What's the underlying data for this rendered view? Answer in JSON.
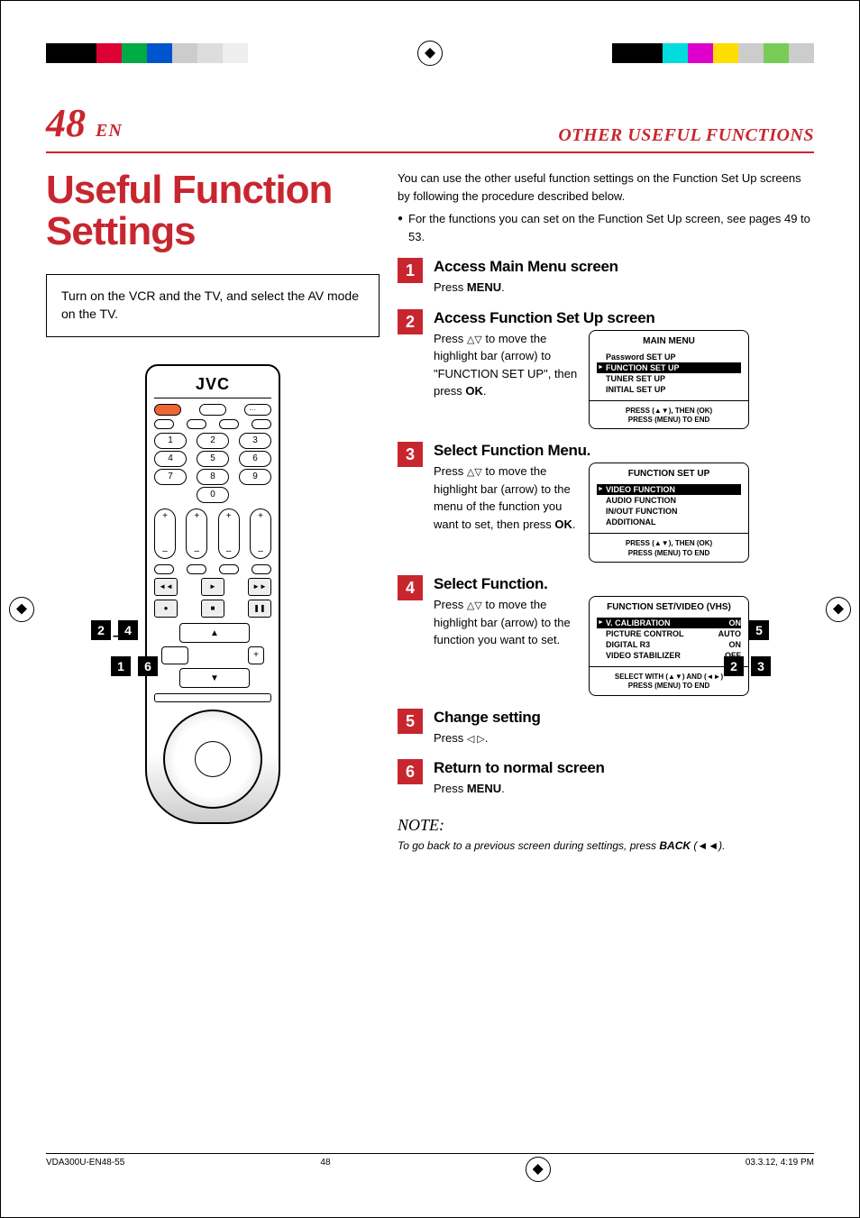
{
  "header": {
    "page_number": "48",
    "lang": "EN",
    "section_title": "OTHER USEFUL FUNCTIONS"
  },
  "main_title_line1": "Useful Function",
  "main_title_line2": "Settings",
  "intro_box": "Turn on the VCR and the TV, and select the AV mode on the TV.",
  "remote": {
    "brand": "JVC",
    "numbers": [
      "1",
      "2",
      "3",
      "4",
      "5",
      "6",
      "7",
      "8",
      "9",
      "0"
    ]
  },
  "callouts": {
    "left_top": [
      "2",
      "4"
    ],
    "left_bottom": [
      "1",
      "6"
    ],
    "right_top": [
      "5"
    ],
    "right_bottom": [
      "2",
      "3"
    ],
    "dash": "–"
  },
  "lead_text": "You can use the other useful function settings on the Function Set Up screens by following the procedure described below.",
  "bullet_text": "For the functions you can set on the Function Set Up screen, see pages 49 to 53.",
  "steps": [
    {
      "n": "1",
      "title": "Access Main Menu screen",
      "text_pre": "Press ",
      "text_bold": "MENU",
      "text_post": "."
    },
    {
      "n": "2",
      "title": "Access Function Set Up screen",
      "text": "Press △▽ to move the highlight bar (arrow) to \"FUNCTION SET UP\", then press OK."
    },
    {
      "n": "3",
      "title": "Select Function Menu.",
      "text": "Press △▽ to move the highlight bar (arrow) to the menu of the function you want to set, then press OK."
    },
    {
      "n": "4",
      "title": "Select Function.",
      "text": "Press △▽ to move the highlight bar (arrow) to the function you want to set."
    },
    {
      "n": "5",
      "title": "Change setting",
      "text": "Press ◁ ▷."
    },
    {
      "n": "6",
      "title": "Return to normal screen",
      "text_pre": "Press ",
      "text_bold": "MENU",
      "text_post": "."
    }
  ],
  "osd1": {
    "title": "MAIN MENU",
    "items": [
      "Password SET UP",
      "FUNCTION SET UP",
      "TUNER SET UP",
      "INITIAL SET UP"
    ],
    "selected": 1,
    "hint1": "PRESS (▲▼), THEN (OK)",
    "hint2": "PRESS (MENU) TO END"
  },
  "osd2": {
    "title": "FUNCTION SET UP",
    "items": [
      "VIDEO FUNCTION",
      "AUDIO FUNCTION",
      "IN/OUT FUNCTION",
      "ADDITIONAL"
    ],
    "selected": 0,
    "hint1": "PRESS (▲▼), THEN (OK)",
    "hint2": "PRESS (MENU) TO END"
  },
  "osd3": {
    "title": "FUNCTION SET/VIDEO (VHS)",
    "rows": [
      {
        "k": "V. CALIBRATION",
        "v": "ON"
      },
      {
        "k": "PICTURE CONTROL",
        "v": "AUTO"
      },
      {
        "k": "DIGITAL R3",
        "v": "ON"
      },
      {
        "k": "VIDEO STABILIZER",
        "v": "OFF"
      }
    ],
    "selected": 0,
    "hint1": "SELECT WITH (▲▼) AND (◄►)",
    "hint2": "PRESS (MENU) TO END"
  },
  "note": {
    "heading": "NOTE:",
    "text_pre": "To go back to a previous screen during settings, press ",
    "text_bold": "BACK",
    "text_post": " (◄◄)."
  },
  "footer": {
    "filename": "VDA300U-EN48-55",
    "page": "48",
    "timestamp": "03.3.12, 4:19 PM"
  }
}
